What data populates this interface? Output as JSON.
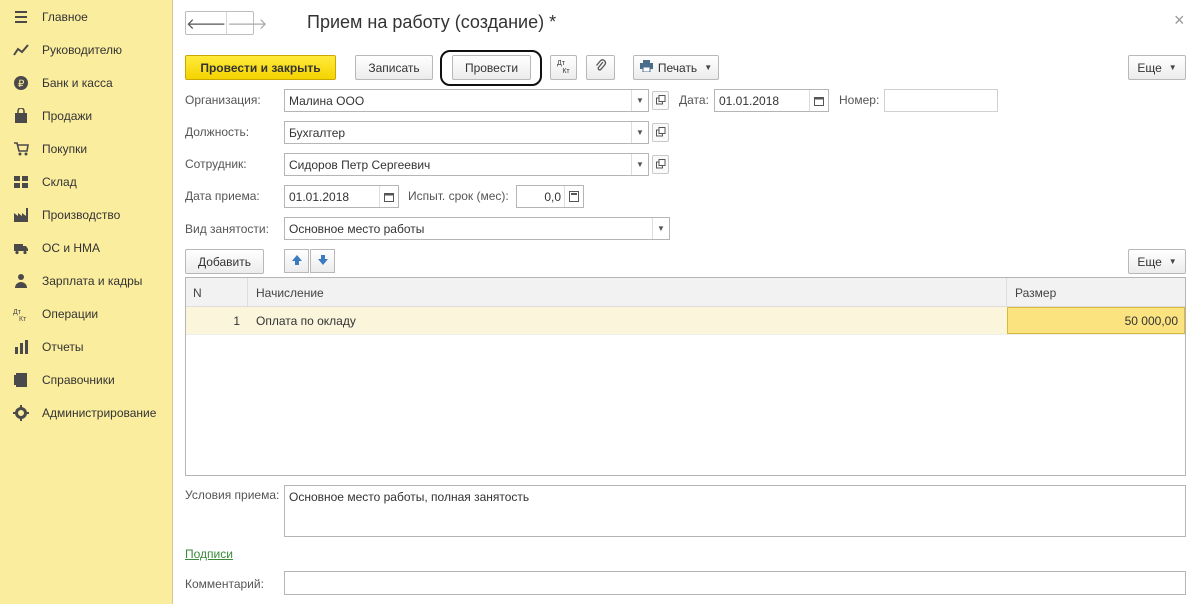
{
  "sidebar": {
    "items": [
      {
        "label": "Главное",
        "icon": "menu-icon"
      },
      {
        "label": "Руководителю",
        "icon": "chart-icon"
      },
      {
        "label": "Банк и касса",
        "icon": "ruble-coin-icon"
      },
      {
        "label": "Продажи",
        "icon": "bag-icon"
      },
      {
        "label": "Покупки",
        "icon": "cart-icon"
      },
      {
        "label": "Склад",
        "icon": "warehouse-icon"
      },
      {
        "label": "Производство",
        "icon": "factory-icon"
      },
      {
        "label": "ОС и НМА",
        "icon": "truck-icon"
      },
      {
        "label": "Зарплата и кадры",
        "icon": "people-icon"
      },
      {
        "label": "Операции",
        "icon": "dt-kt-icon"
      },
      {
        "label": "Отчеты",
        "icon": "bar-chart-icon"
      },
      {
        "label": "Справочники",
        "icon": "book-icon"
      },
      {
        "label": "Администрирование",
        "icon": "gear-icon"
      }
    ]
  },
  "header": {
    "title": "Прием на работу (создание) *",
    "back_glyph": "🡐",
    "forward_glyph": "🡒",
    "close_glyph": "×"
  },
  "toolbar": {
    "post_and_close": "Провести и закрыть",
    "save": "Записать",
    "post": "Провести",
    "dt_kt_top": "Дт",
    "dt_kt_bottom": "Кт",
    "print": "Печать",
    "more": "Еще"
  },
  "form": {
    "organization_label": "Организация:",
    "organization_value": "Малина ООО",
    "date_label": "Дата:",
    "date_value": "01.01.2018",
    "number_label": "Номер:",
    "number_value": "",
    "position_label": "Должность:",
    "position_value": "Бухгалтер",
    "employee_label": "Сотрудник:",
    "employee_value": "Сидоров Петр Сергеевич",
    "hire_date_label": "Дата приема:",
    "hire_date_value": "01.01.2018",
    "probation_label": "Испыт. срок (мес):",
    "probation_value": "0,0",
    "employment_type_label": "Вид занятости:",
    "employment_type_value": "Основное место работы"
  },
  "table_toolbar": {
    "add": "Добавить",
    "more": "Еще"
  },
  "table": {
    "columns": [
      "N",
      "Начисление",
      "Размер"
    ],
    "rows": [
      {
        "n": "1",
        "accrual": "Оплата по окладу",
        "amount": "50 000,00"
      }
    ]
  },
  "conditions": {
    "label": "Условия приема:",
    "value": "Основное место работы, полная занятость"
  },
  "signatures_link": "Подписи",
  "comment": {
    "label": "Комментарий:",
    "value": ""
  },
  "colors": {
    "sidebar_bg": "#fbed9e",
    "primary_button": "#f5d400",
    "selected_row": "#fbf5dc",
    "active_cell": "#fbe37f",
    "link": "#3a8a3a"
  }
}
